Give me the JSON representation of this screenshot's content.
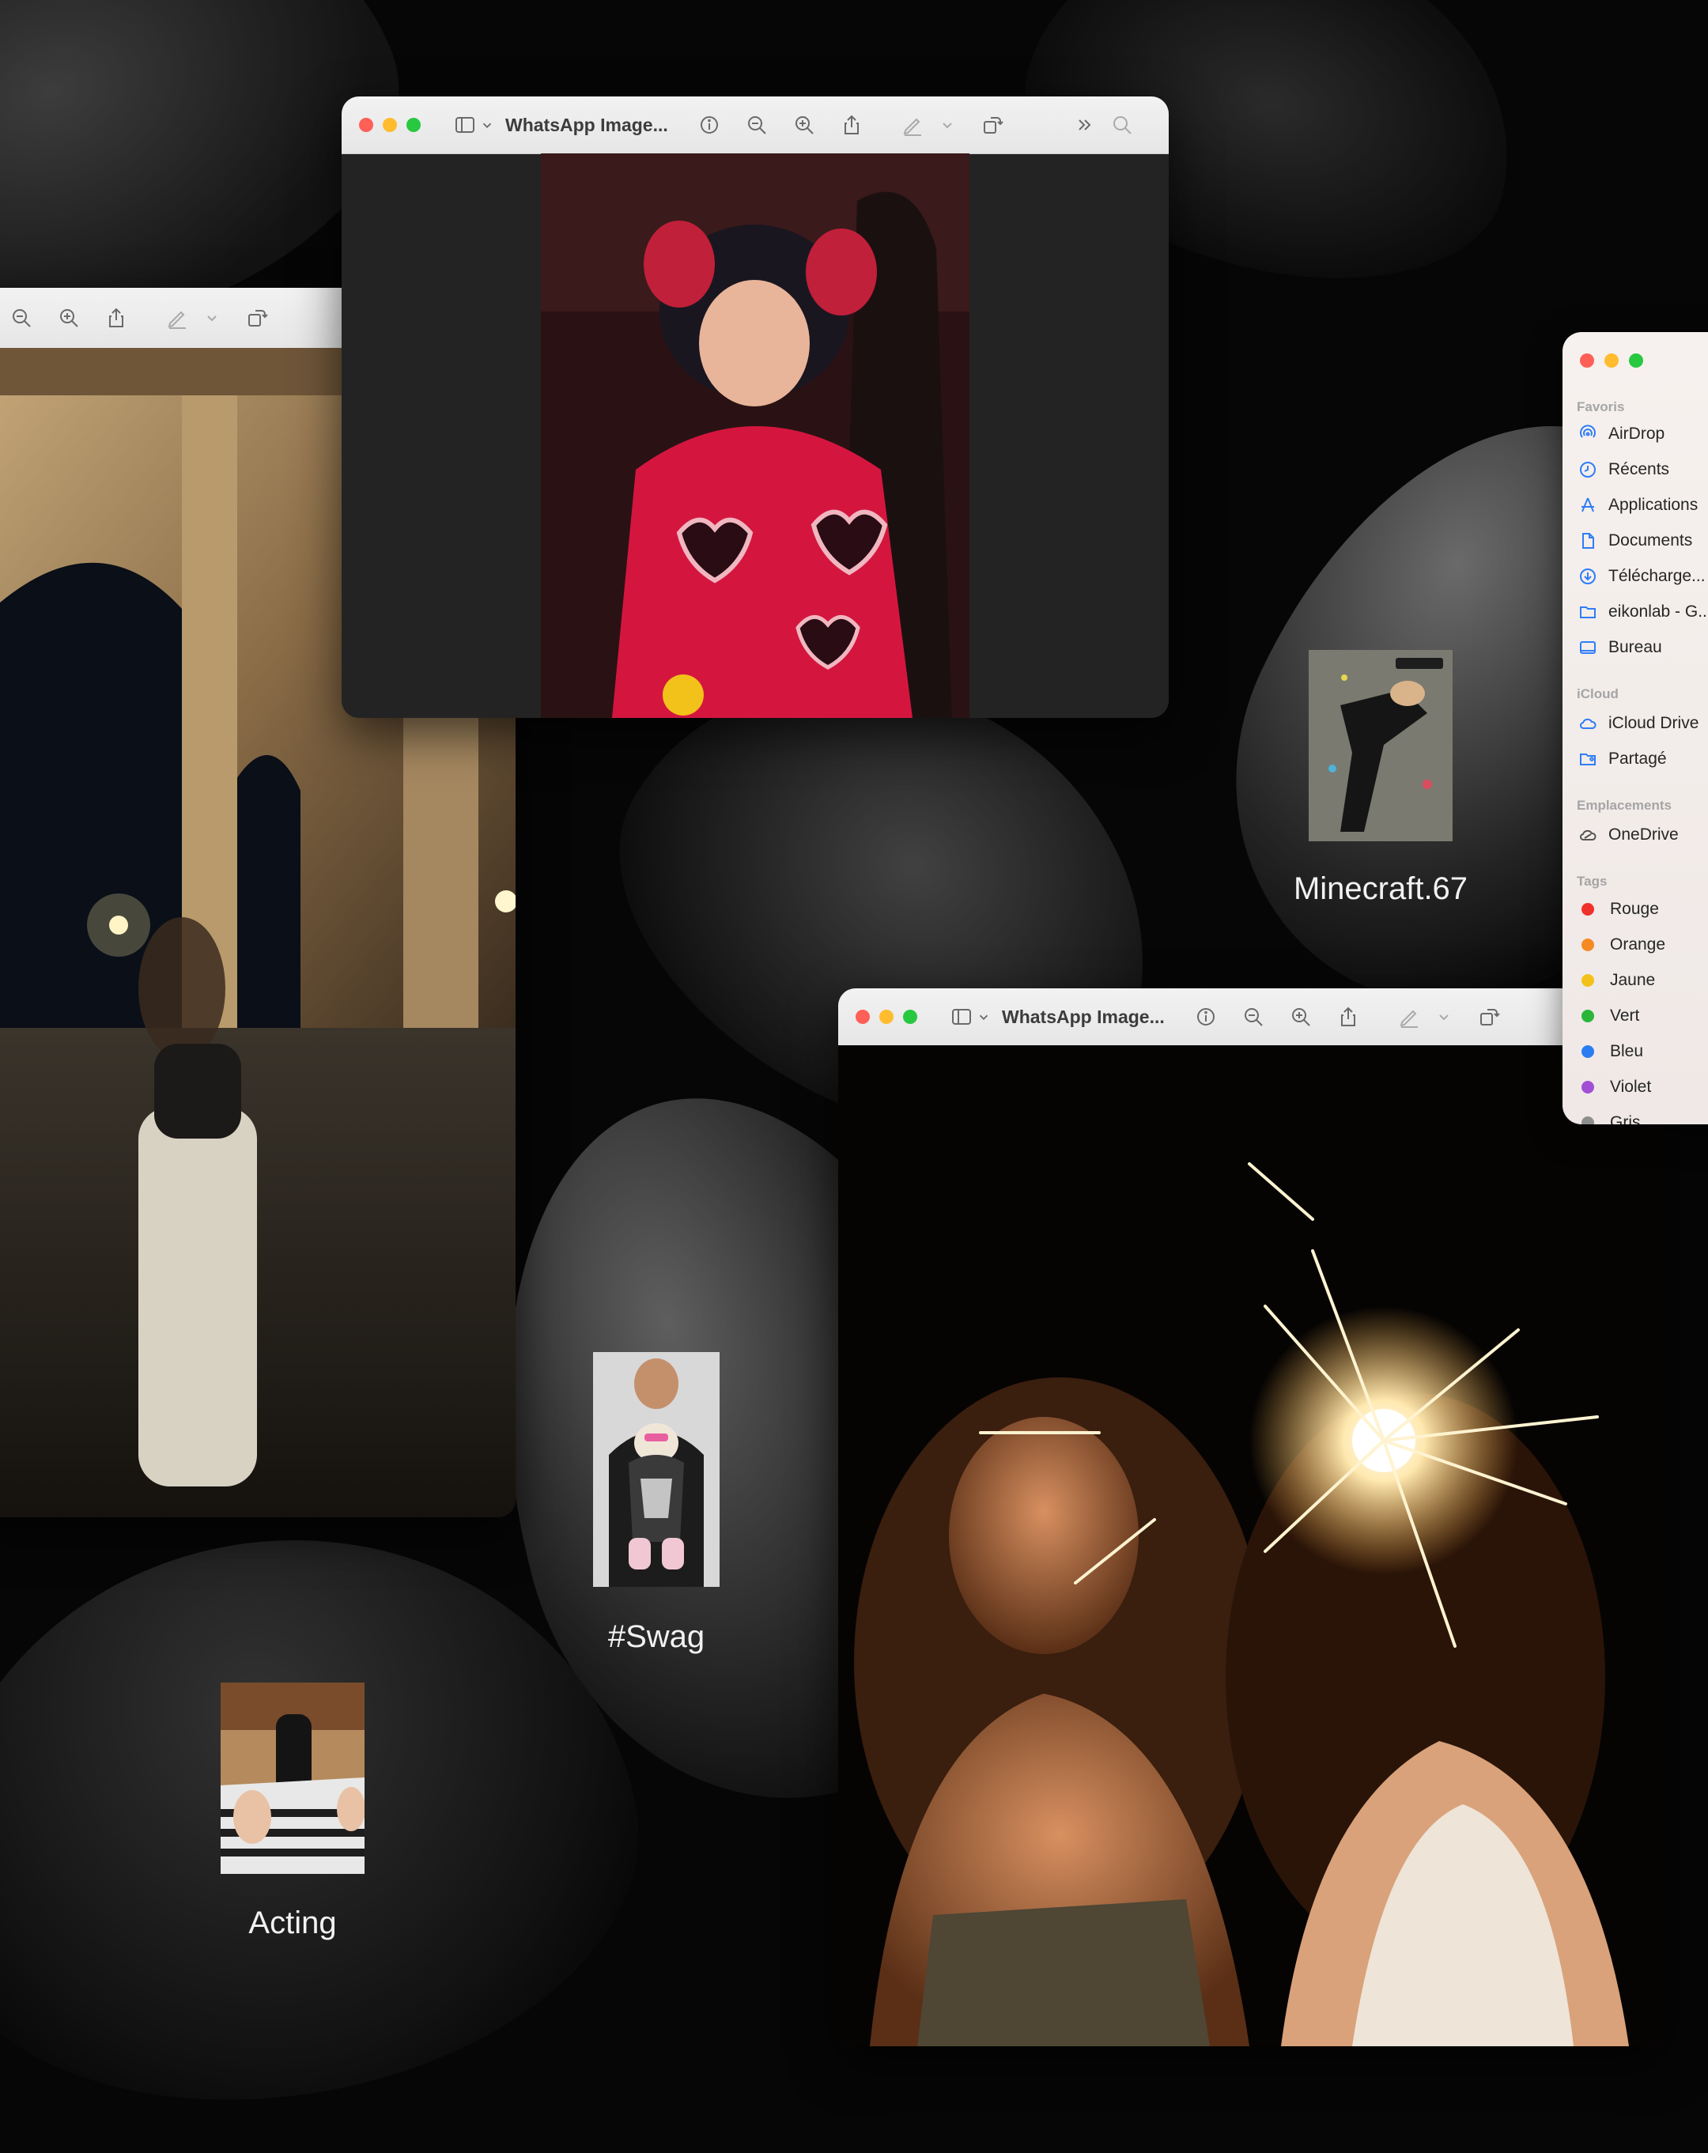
{
  "windows": {
    "top": {
      "title": "WhatsApp Image..."
    },
    "left": {},
    "bottom": {
      "title": "WhatsApp Image..."
    }
  },
  "thumbnails": {
    "minecraft": {
      "caption": "Minecraft.67"
    },
    "swag": {
      "caption": "#Swag"
    },
    "acting": {
      "caption": "Acting"
    }
  },
  "finder": {
    "favorites_heading": "Favoris",
    "favorites": [
      {
        "label": "AirDrop",
        "icon": "airdrop-icon"
      },
      {
        "label": "Récents",
        "icon": "clock-icon"
      },
      {
        "label": "Applications",
        "icon": "applications-icon"
      },
      {
        "label": "Documents",
        "icon": "document-icon"
      },
      {
        "label": "Télécharge...",
        "icon": "download-icon"
      },
      {
        "label": "eikonlab - G...",
        "icon": "folder-icon"
      },
      {
        "label": "Bureau",
        "icon": "desktop-icon"
      }
    ],
    "icloud_heading": "iCloud",
    "icloud": [
      {
        "label": "iCloud Drive",
        "icon": "cloud-icon"
      },
      {
        "label": "Partagé",
        "icon": "shared-folder-icon"
      }
    ],
    "locations_heading": "Emplacements",
    "locations": [
      {
        "label": "OneDrive",
        "icon": "onedrive-icon"
      }
    ],
    "tags_heading": "Tags",
    "tags": [
      {
        "label": "Rouge",
        "color": "#f0312b"
      },
      {
        "label": "Orange",
        "color": "#f58a25"
      },
      {
        "label": "Jaune",
        "color": "#f3c21a"
      },
      {
        "label": "Vert",
        "color": "#2ab63a"
      },
      {
        "label": "Bleu",
        "color": "#2a7cf2"
      },
      {
        "label": "Violet",
        "color": "#a24fd6"
      },
      {
        "label": "Gris",
        "color": "#8e8e8e"
      }
    ]
  },
  "colors": {
    "background": "#060606",
    "toolbar": "#ececec",
    "accent": "#2f7df6"
  }
}
